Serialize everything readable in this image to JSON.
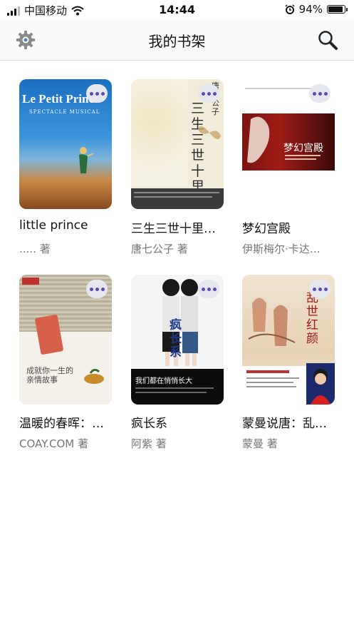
{
  "status_bar": {
    "carrier": "中国移动",
    "time": "14:44",
    "battery": "94%",
    "battery_level": 0.94
  },
  "nav": {
    "title": "我的书架",
    "left_icon": "gear-icon",
    "right_icon": "search-icon"
  },
  "books": [
    {
      "title": "little prince",
      "author": "..... 著",
      "cover_text_1": "Le Petit Prince",
      "cover_text_2": "SPECTACLE MUSICAL"
    },
    {
      "title": "三生三世十里…",
      "author": "唐七公子 著",
      "cover_text_1": "唐七公子",
      "cover_text_2": "三生三世 十里桃花"
    },
    {
      "title": "梦幻宫殿",
      "author": "伊斯梅尔·卡达…",
      "cover_text_1": "梦幻宫殿"
    },
    {
      "title": "温暖的春晖：…",
      "author": "COAY.COM 著",
      "cover_text_1": "成就你一生的 亲情故事"
    },
    {
      "title": "疯长系",
      "author": "阿紫 著",
      "cover_text_1": "疯长系",
      "cover_text_2": "我们都在悄悄长大"
    },
    {
      "title": "蒙曼说唐：乱…",
      "author": "蒙曼 著",
      "cover_text_1": "乱世红颜"
    }
  ],
  "colors": {
    "accent_dots": "#5b4bb8",
    "author_gray": "#777777"
  }
}
